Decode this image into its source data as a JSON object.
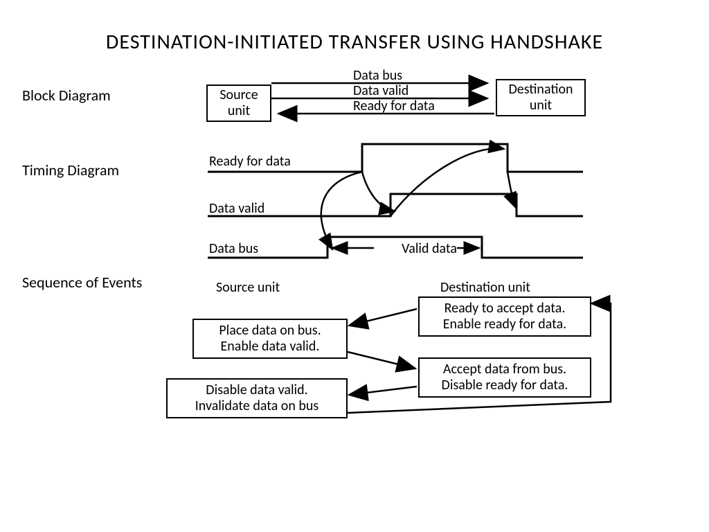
{
  "title": "DESTINATION-INITIATED  TRANSFER  USING  HANDSHAKE",
  "labels": {
    "block": "Block Diagram",
    "timing": "Timing Diagram",
    "sequence": "Sequence of Events"
  },
  "block": {
    "source": "Source\nunit",
    "dest": "Destination\nunit",
    "data_bus": "Data bus",
    "data_valid": "Data valid",
    "ready": "Ready for data"
  },
  "timing": {
    "ready": "Ready for data",
    "valid": "Data valid",
    "bus": "Data bus",
    "valid_data": "Valid data"
  },
  "seq": {
    "src_header": "Source unit",
    "dst_header": "Destination unit",
    "dst1_line1": "Ready to accept data.",
    "dst1_line2": "Enable ready for data.",
    "src1_line1": "Place data on bus.",
    "src1_line2": "Enable data valid.",
    "dst2_line1": "Accept data from bus.",
    "dst2_line2": "Disable ready for data.",
    "src2_line1": "Disable data valid.",
    "src2_line2": "Invalidate data on bus"
  }
}
